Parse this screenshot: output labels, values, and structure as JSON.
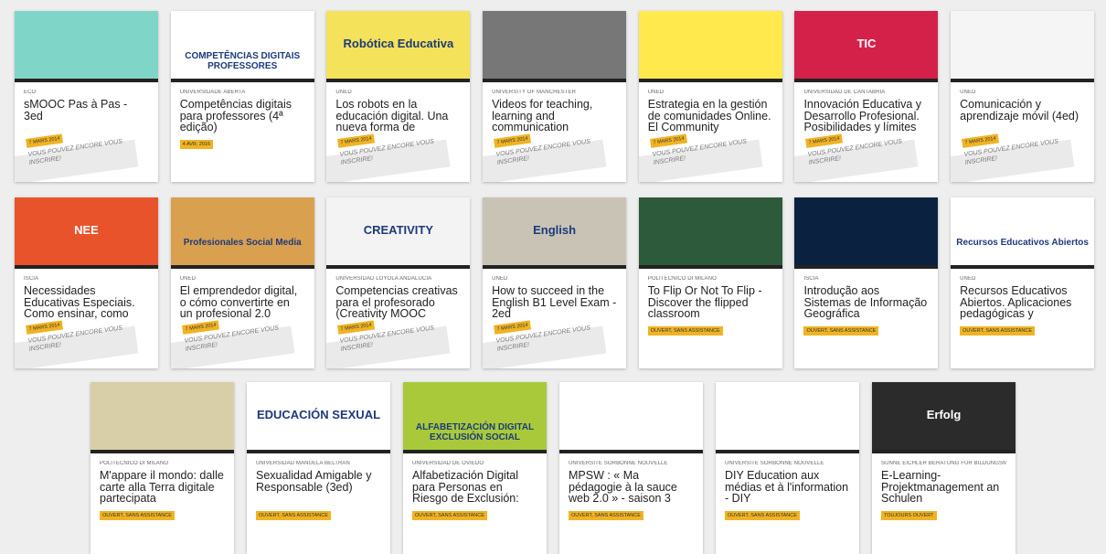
{
  "row1": [
    {
      "inst": "ECO",
      "title": "sMOOC Pas à Pas - 3ed",
      "badge": "7 MARS 2014",
      "note": "VOUS POUVEZ ENCORE VOUS INSCRIRE!",
      "thumb_bg": "#7fd6c8",
      "thumb_text": ""
    },
    {
      "inst": "UNIVERSIDADE ABERTA",
      "title": "Competências digitais para professores (4ª edição)",
      "badge": "4 AVR. 2016",
      "note": "",
      "thumb_bg": "#ffffff",
      "thumb_text": "COMPETÊNCIAS DIGITAIS PROFESSORES"
    },
    {
      "inst": "UNED",
      "title": "Los robots en la educación digital. Una nueva forma de",
      "badge": "7 MARS 2014",
      "note": "VOUS POUVEZ ENCORE VOUS INSCRIRE!",
      "thumb_bg": "#f4e25a",
      "thumb_text": "Robótica Educativa"
    },
    {
      "inst": "UNIVERSITY OF MANCHESTER",
      "title": "Videos for teaching, learning and communication",
      "badge": "7 MARS 2014",
      "note": "VOUS POUVEZ ENCORE VOUS INSCRIRE!",
      "thumb_bg": "#777777",
      "thumb_text": ""
    },
    {
      "inst": "UNED",
      "title": "Estrategia en la gestión de comunidades Online. El Community",
      "badge": "7 MARS 2014",
      "note": "VOUS POUVEZ ENCORE VOUS INSCRIRE!",
      "thumb_bg": "#ffe94d",
      "thumb_text": ""
    },
    {
      "inst": "UNIVERSIDAD DE CANTABRIA",
      "title": "Innovación Educativa y Desarrollo Profesional. Posibilidades y límites",
      "badge": "7 MARS 2014",
      "note": "VOUS POUVEZ ENCORE VOUS INSCRIRE!",
      "thumb_bg": "#d4214a",
      "thumb_text": "TIC"
    },
    {
      "inst": "UNED",
      "title": "Comunicación y aprendizaje móvil (4ed)",
      "badge": "7 MARS 2014",
      "note": "VOUS POUVEZ ENCORE VOUS INSCRIRE!",
      "thumb_bg": "#f5f5f5",
      "thumb_text": ""
    }
  ],
  "row2": [
    {
      "inst": "ISCIA",
      "title": "Necessidades Educativas Especiais. Como ensinar, como",
      "badge": "7 MARS 2014",
      "note": "VOUS POUVEZ ENCORE VOUS INSCRIRE!",
      "thumb_bg": "#e8532b",
      "thumb_text": "NEE"
    },
    {
      "inst": "UNED",
      "title": "El emprendedor digital, o cómo convertirte en un profesional 2.0",
      "badge": "7 MARS 2014",
      "note": "VOUS POUVEZ ENCORE VOUS INSCRIRE!",
      "thumb_bg": "#d9a04f",
      "thumb_text": "Profesionales Social Media"
    },
    {
      "inst": "UNIVERSIDAD LOYOLA ANDALUCÍA",
      "title": "Competencias creativas para el profesorado (Creativity MOOC",
      "badge": "7 MARS 2014",
      "note": "VOUS POUVEZ ENCORE VOUS INSCRIRE!",
      "thumb_bg": "#f3f3f3",
      "thumb_text": "CREATIVITY"
    },
    {
      "inst": "UNED",
      "title": "How to succeed in the English B1 Level Exam - 2ed",
      "badge": "7 MARS 2014",
      "note": "VOUS POUVEZ ENCORE VOUS INSCRIRE!",
      "thumb_bg": "#c9c3b6",
      "thumb_text": "English"
    },
    {
      "inst": "POLITECNICO DI MILANO",
      "title": "To Flip Or Not To Flip - Discover the flipped classroom",
      "badge": "OUVERT, SANS ASSISTANCE",
      "note": "",
      "thumb_bg": "#2d5a3a",
      "thumb_text": ""
    },
    {
      "inst": "ISCIA",
      "title": "Introdução aos Sistemas de Informação Geográfica",
      "badge": "OUVERT, SANS ASSISTANCE",
      "note": "",
      "thumb_bg": "#0a2240",
      "thumb_text": ""
    },
    {
      "inst": "UNED",
      "title": "Recursos Educativos Abiertos. Aplicaciones pedagógicas y",
      "badge": "OUVERT, SANS ASSISTANCE",
      "note": "",
      "thumb_bg": "#ffffff",
      "thumb_text": "Recursos Educativos Abiertos"
    }
  ],
  "row3": [
    {
      "inst": "POLITECNICO DI MILANO",
      "title": "M'appare il mondo: dalle carte alla Terra digitale partecipata",
      "badge": "OUVERT, SANS ASSISTANCE",
      "thumb_bg": "#d8cfa8",
      "thumb_text": ""
    },
    {
      "inst": "UNIVERSIDAD MANUELA BELTRÁN",
      "title": "Sexualidad Amigable y Responsable (3ed)",
      "badge": "OUVERT, SANS ASSISTANCE",
      "thumb_bg": "#ffffff",
      "thumb_text": "EDUCACIÓN SEXUAL"
    },
    {
      "inst": "UNIVERSIDAD DE OVIEDO",
      "title": "Alfabetización Digital para Personas en Riesgo de Exclusión:",
      "badge": "OUVERT, SANS ASSISTANCE",
      "thumb_bg": "#a9c93b",
      "thumb_text": "ALFABETIZACIÓN DIGITAL EXCLUSIÓN SOCIAL"
    },
    {
      "inst": "UNIVERSITE  SORBONNE NOUVELLE",
      "title": "MPSW : « Ma pédagogie à la sauce web 2.0 » - saison 3",
      "badge": "OUVERT, SANS ASSISTANCE",
      "thumb_bg": "#ffffff",
      "thumb_text": ""
    },
    {
      "inst": "UNIVERSITE  SORBONNE NOUVELLE",
      "title": "DIY Education aux médias et à l'information - DIY",
      "badge": "OUVERT, SANS ASSISTANCE",
      "thumb_bg": "#ffffff",
      "thumb_text": ""
    },
    {
      "inst": "SÜNNE EICHLER BERATUNG FÜR BILDUNGSMANAGEMENT",
      "title": "E-Learning-Projektmanagement an Schulen",
      "badge": "TOUJOURS OUVERT",
      "thumb_bg": "#2b2b2b",
      "thumb_text": "Erfolg"
    }
  ]
}
